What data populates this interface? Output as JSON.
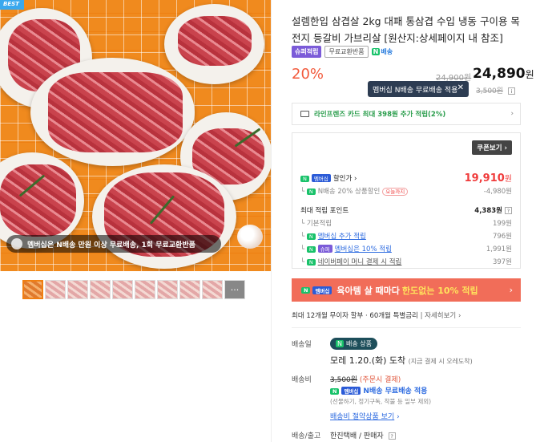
{
  "hero": {
    "best_label": "BEST",
    "banner_text": "멤버십은 N배송 만원 이상 무료배송, 1회 무료교환반품",
    "thumb_more": "···"
  },
  "product": {
    "title": "설렘한입 삼겹살 2kg 대패 통삼겹 수입 냉동 구이용 목전지 등갈비 가브리살 [원산지:상세페이지 내 참조]",
    "badge_super": "슈퍼적립",
    "badge_free": "무료교환반품",
    "badge_ship_n": "N",
    "badge_ship_label": "배송"
  },
  "price": {
    "discount": "20%",
    "original": "24,900원",
    "final": "24,890",
    "unit": "원",
    "tooltip": "멤버십 N배송 무료배송 적용",
    "tooltip_close": "✕",
    "ship_fee_strike": "3,500원"
  },
  "card_benefit": {
    "text": "라인프렌즈 카드 최대 398원 추가 적립(2%)",
    "chevron": "›"
  },
  "benefits": {
    "coupon_button": "쿠폰보기",
    "sale_label": "할인가",
    "sale_price": "19,910",
    "sale_unit": "원",
    "n_discount_label": "N배송 20% 상품할인",
    "n_discount_tag": "오늘까지",
    "n_discount_value": "-4,980원",
    "points_label": "최대 적립 포인트",
    "points_value": "4,383원",
    "base_label": "기본적립",
    "base_value": "199원",
    "member_extra_label": "멤버십 추가 적립",
    "member_extra_value": "796원",
    "member_10_label": "멤버십은 10% 적립",
    "member_10_value": "1,991원",
    "naverpay_label": "네이버페이 머니 결제 시 적립",
    "naverpay_value": "397원",
    "npay_badge": "N",
    "member_badge": "멤버십",
    "super_badge": "슈퍼"
  },
  "promo": {
    "text_a": "육아템 살 때마다",
    "text_hl": "한도없는 10% 적립",
    "chevron": "›"
  },
  "installment": {
    "text": "최대 12개월 무이자 할부 · 60개월 특별금리",
    "link": "자세히보기"
  },
  "delivery": {
    "label_date": "배송일",
    "ship_badge": "배송 상품",
    "arrive_text": "모레 1.20.(화) 도착",
    "arrive_note": "(지금 결제 시 오레도착)",
    "label_fee": "배송비",
    "fee_strike": "3,500원",
    "fee_note": "(주문시 결제)",
    "fee_applied": "N배송 무료배송 적용",
    "fee_exclude": "(선물하기, 정기구독, 착불 등 일부 제외)",
    "fee_link": "배송비 절약상품 보기",
    "label_release": "배송/출고",
    "release_value": "한진택배 / 판매자"
  }
}
